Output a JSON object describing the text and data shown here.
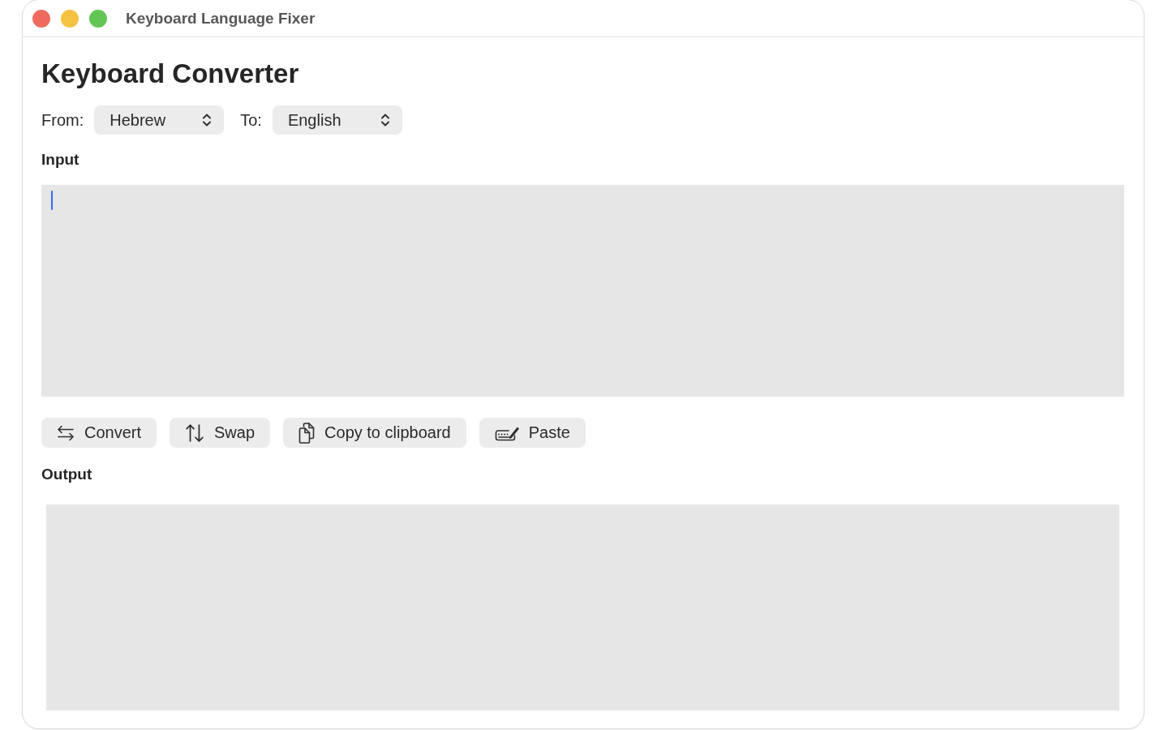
{
  "window": {
    "title": "Keyboard Language Fixer"
  },
  "heading": "Keyboard Converter",
  "selectors": [
    {
      "label": "From:",
      "value": "Hebrew"
    },
    {
      "label": "To:",
      "value": "English"
    }
  ],
  "input": {
    "label": "Input",
    "focused": true
  },
  "buttons": [
    {
      "kind": "convert",
      "label": "Convert"
    },
    {
      "kind": "swap",
      "label": "Swap"
    },
    {
      "kind": "copy",
      "label": "Copy to clipboard"
    },
    {
      "kind": "paste",
      "label": "Paste"
    }
  ],
  "output": {
    "label": "Output"
  }
}
